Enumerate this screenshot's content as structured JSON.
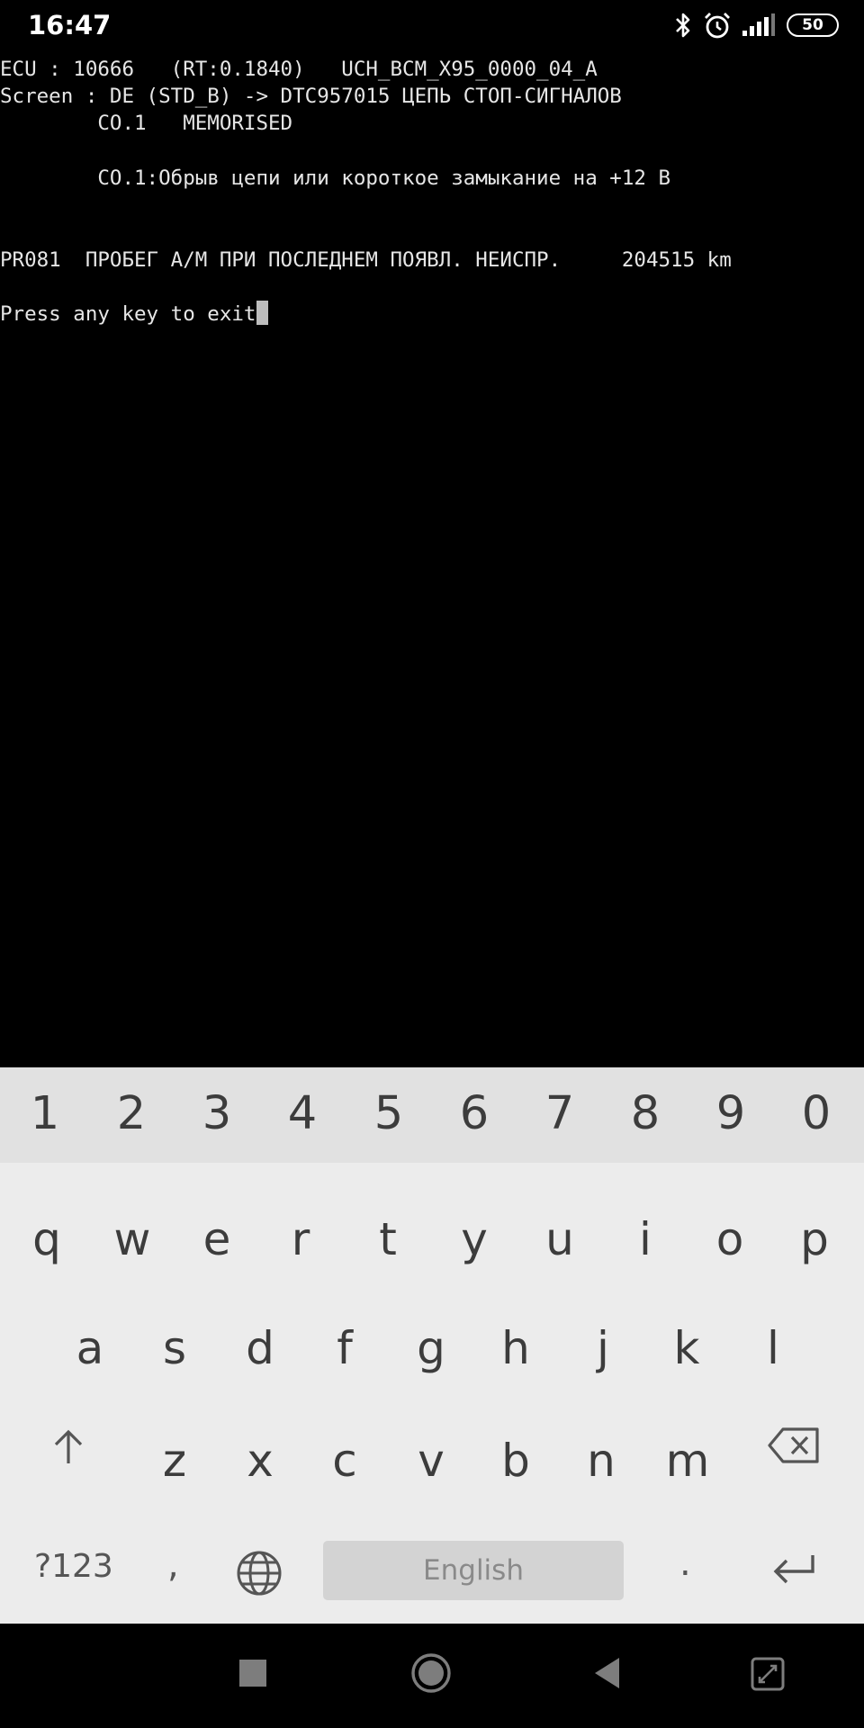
{
  "status_bar": {
    "time": "16:47",
    "battery_level": "50",
    "icons": [
      "bluetooth-icon",
      "alarm-icon",
      "signal-icon",
      "battery-icon"
    ]
  },
  "terminal": {
    "lines": [
      "ECU : 10666   (RT:0.1840)   UCH_BCM_X95_0000_04_A",
      "Screen : DE (STD_B) -> DTC957015 ЦЕПЬ СТОП-СИГНАЛОВ",
      "        CO.1   MEMORISED",
      "",
      "        CO.1:Обрыв цепи или короткое замыкание на +12 В",
      "",
      "",
      "PR081  ПРОБЕГ А/М ПРИ ПОСЛЕДНЕМ ПОЯВЛ. НЕИСПР.     204515 km",
      "",
      "Press any key to exit"
    ]
  },
  "keyboard": {
    "number_row": [
      "1",
      "2",
      "3",
      "4",
      "5",
      "6",
      "7",
      "8",
      "9",
      "0"
    ],
    "row1": [
      "q",
      "w",
      "e",
      "r",
      "t",
      "y",
      "u",
      "i",
      "o",
      "p"
    ],
    "row2": [
      "a",
      "s",
      "d",
      "f",
      "g",
      "h",
      "j",
      "k",
      "l"
    ],
    "row3": [
      "z",
      "x",
      "c",
      "v",
      "b",
      "n",
      "m"
    ],
    "symbols_label": "?123",
    "comma_label": ",",
    "space_label": "English",
    "period_label": ".",
    "colors": {
      "background": "#ececec",
      "number_row": "#e1e1e1",
      "spacebar": "#d3d3d3",
      "key_text": "#3c3c3c"
    }
  },
  "nav_bar": {
    "buttons": [
      "recents-square-icon",
      "home-circle-icon",
      "back-triangle-icon",
      "screenshot-icon"
    ]
  }
}
